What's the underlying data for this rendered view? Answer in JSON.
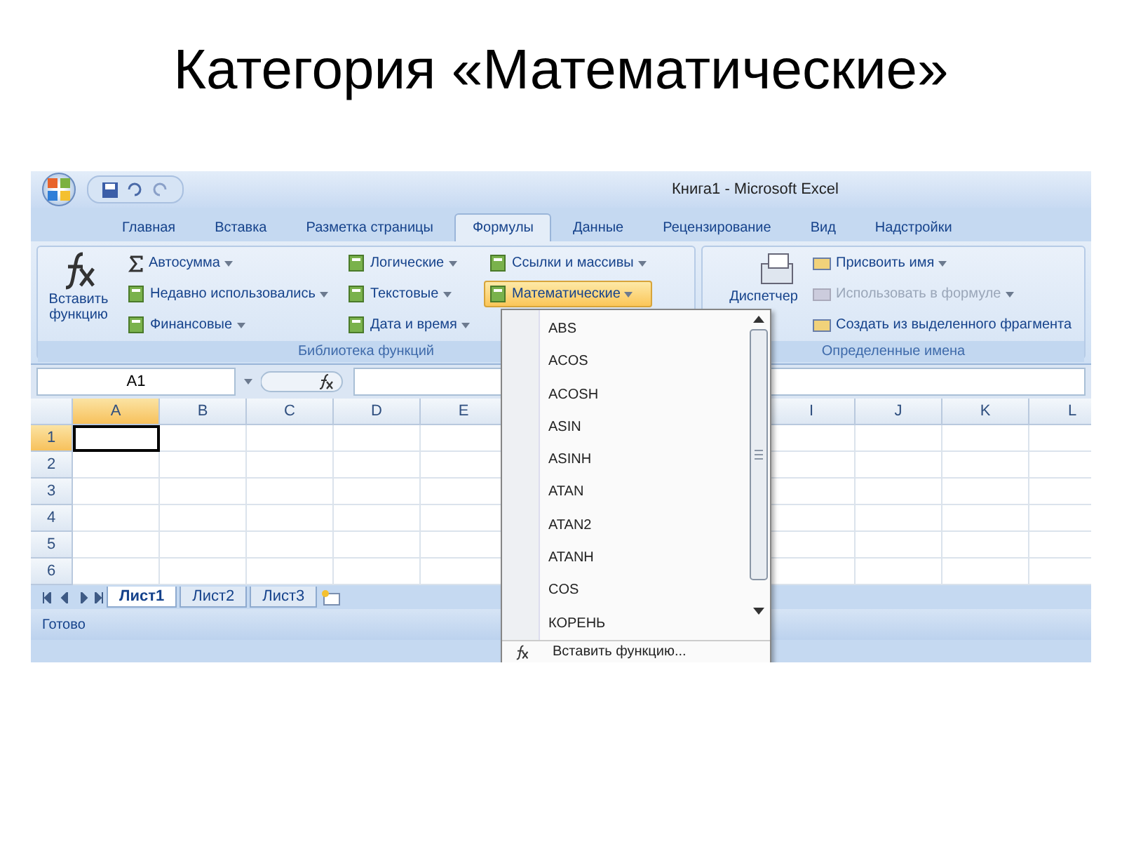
{
  "slide_title": "Категория «Математические»",
  "window": {
    "title": "Книга1 - Microsoft Excel"
  },
  "tabs": [
    {
      "label": "Главная",
      "selected": false
    },
    {
      "label": "Вставка",
      "selected": false
    },
    {
      "label": "Разметка страницы",
      "selected": false
    },
    {
      "label": "Формулы",
      "selected": true
    },
    {
      "label": "Данные",
      "selected": false
    },
    {
      "label": "Рецензирование",
      "selected": false
    },
    {
      "label": "Вид",
      "selected": false
    },
    {
      "label": "Надстройки",
      "selected": false
    }
  ],
  "function_library": {
    "label": "Библиотека функций",
    "insert_button": "Вставить функцию",
    "columns": [
      [
        {
          "label": "Автосумма",
          "kind": "sum",
          "active": false
        },
        {
          "label": "Недавно использовались",
          "kind": "book",
          "active": false
        },
        {
          "label": "Финансовые",
          "kind": "book",
          "active": false
        }
      ],
      [
        {
          "label": "Логические",
          "kind": "book",
          "active": false
        },
        {
          "label": "Текстовые",
          "kind": "book",
          "active": false
        },
        {
          "label": "Дата и время",
          "kind": "book",
          "active": false
        }
      ],
      [
        {
          "label": "Ссылки и массивы",
          "kind": "book",
          "active": false
        },
        {
          "label": "Математические",
          "kind": "book",
          "active": true
        }
      ]
    ]
  },
  "defined_names": {
    "label": "Определенные имена",
    "manager_button": "Диспетчер",
    "items": [
      {
        "label": "Присвоить имя",
        "disabled": false,
        "menu": true
      },
      {
        "label": "Использовать в формуле",
        "disabled": true,
        "menu": true
      },
      {
        "label": "Создать из выделенного фрагмента",
        "disabled": false,
        "menu": false
      }
    ]
  },
  "name_box": "A1",
  "columns_left": [
    {
      "label": "A",
      "selected": true
    },
    {
      "label": "B",
      "selected": false
    },
    {
      "label": "C",
      "selected": false
    },
    {
      "label": "D",
      "selected": false
    },
    {
      "label": "E",
      "selected": false
    }
  ],
  "columns_right": [
    {
      "label": "I",
      "selected": false
    },
    {
      "label": "J",
      "selected": false
    },
    {
      "label": "K",
      "selected": false
    },
    {
      "label": "L",
      "selected": false
    }
  ],
  "rows": [
    {
      "label": "1",
      "selected": true
    },
    {
      "label": "2",
      "selected": false
    },
    {
      "label": "3",
      "selected": false
    },
    {
      "label": "4",
      "selected": false
    },
    {
      "label": "5",
      "selected": false
    },
    {
      "label": "6",
      "selected": false
    }
  ],
  "sheets": [
    {
      "label": "Лист1",
      "selected": true
    },
    {
      "label": "Лист2",
      "selected": false
    },
    {
      "label": "Лист3",
      "selected": false
    }
  ],
  "status": "Готово",
  "math_menu": {
    "items": [
      "ABS",
      "ACOS",
      "ACOSH",
      "ASIN",
      "ASINH",
      "ATAN",
      "ATAN2",
      "ATANH",
      "COS",
      "КОРЕНЬ"
    ],
    "footer": "Вставить функцию..."
  }
}
